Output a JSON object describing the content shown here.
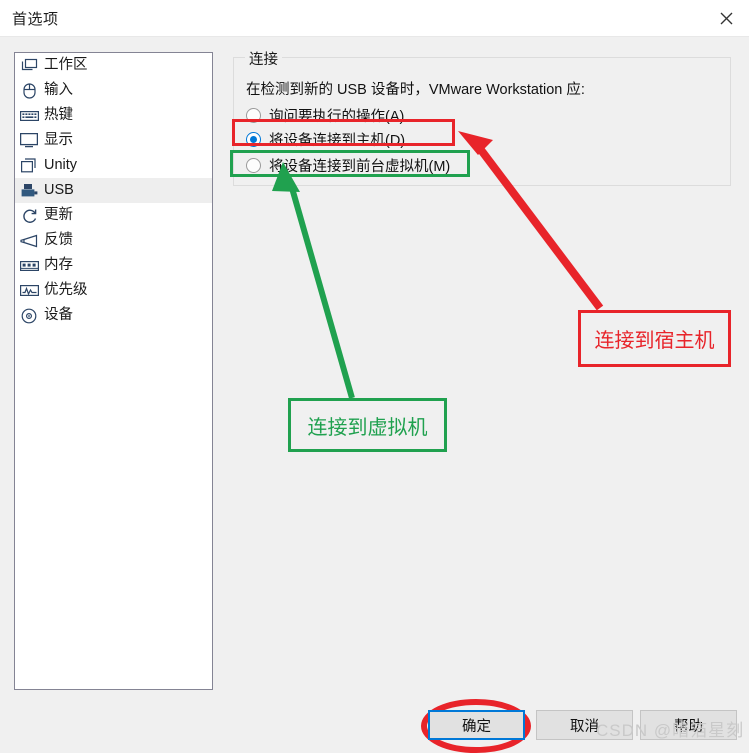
{
  "window": {
    "title": "首选项",
    "close_icon": "close-icon"
  },
  "sidebar": {
    "items": [
      {
        "label": "工作区",
        "icon": "workspace-icon",
        "selected": false
      },
      {
        "label": "输入",
        "icon": "mouse-icon",
        "selected": false
      },
      {
        "label": "热键",
        "icon": "keyboard-icon",
        "selected": false
      },
      {
        "label": "显示",
        "icon": "monitor-icon",
        "selected": false
      },
      {
        "label": "Unity",
        "icon": "windows-icon",
        "selected": false
      },
      {
        "label": "USB",
        "icon": "usb-icon",
        "selected": true
      },
      {
        "label": "更新",
        "icon": "refresh-icon",
        "selected": false
      },
      {
        "label": "反馈",
        "icon": "megaphone-icon",
        "selected": false
      },
      {
        "label": "内存",
        "icon": "memory-icon",
        "selected": false
      },
      {
        "label": "优先级",
        "icon": "pulse-icon",
        "selected": false
      },
      {
        "label": "设备",
        "icon": "disc-icon",
        "selected": false
      }
    ]
  },
  "main": {
    "group_title": "连接",
    "description": "在检测到新的 USB 设备时，VMware Workstation 应:",
    "radios": [
      {
        "label": "询问要执行的操作(A)",
        "checked": false
      },
      {
        "label": "将设备连接到主机(D)",
        "checked": true
      },
      {
        "label": "将设备连接到前台虚拟机(M)",
        "checked": false
      }
    ]
  },
  "annotations": {
    "red_label": "连接到宿主机",
    "green_label": "连接到虚拟机",
    "red_color": "#e8242a",
    "green_color": "#20a14f"
  },
  "footer": {
    "ok_label": "确定",
    "cancel_label": "取消",
    "help_label": "帮助"
  },
  "watermark": {
    "text": "CSDN @暗箔星刻"
  }
}
